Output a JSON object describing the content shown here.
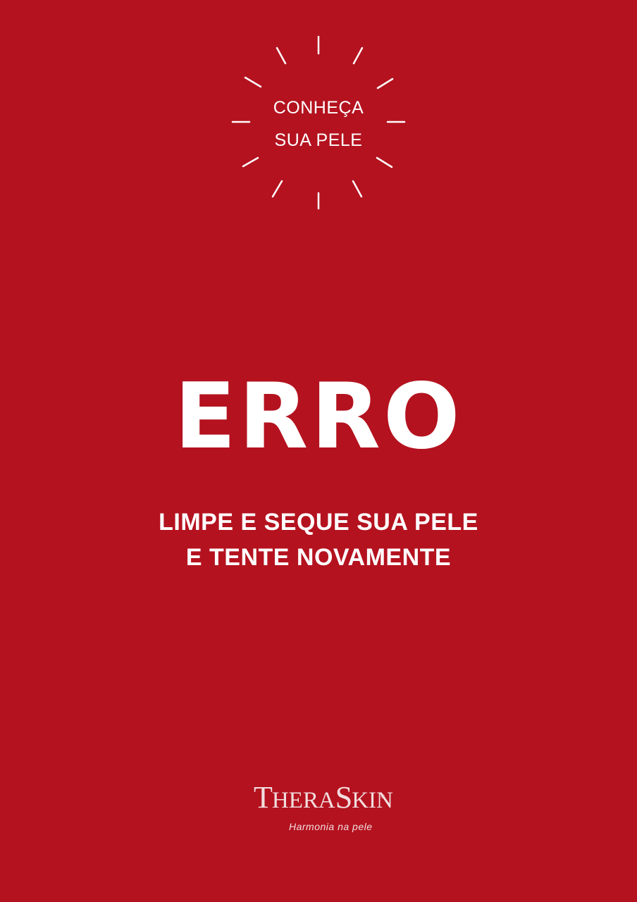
{
  "badge": {
    "line1": "CONHEÇA",
    "line2": "SUA PELE",
    "icon": "sunburst-rays"
  },
  "error": {
    "title": "ERRO",
    "message_line1": "LIMPE E SEQUE SUA PELE",
    "message_line2": "E TENTE NOVAMENTE"
  },
  "brand": {
    "name_part1": "T",
    "name_part2": "HERA",
    "name_part3": "S",
    "name_part4": "KIN",
    "registered": "®",
    "tagline": "Harmonia na pele"
  },
  "colors": {
    "background": "#b4121f",
    "text": "#ffffff",
    "logo": "#f2dedf"
  }
}
